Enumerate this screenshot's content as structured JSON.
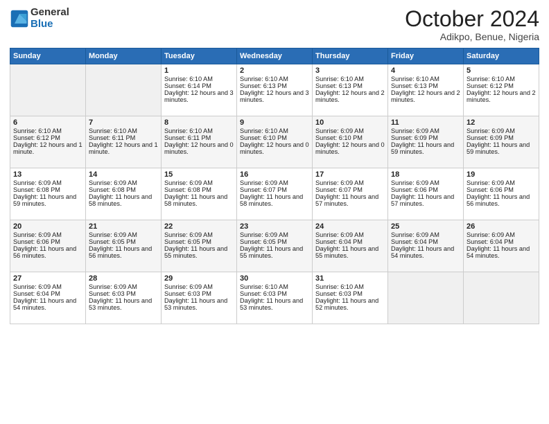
{
  "header": {
    "logo_general": "General",
    "logo_blue": "Blue",
    "month": "October 2024",
    "location": "Adikpo, Benue, Nigeria"
  },
  "days_of_week": [
    "Sunday",
    "Monday",
    "Tuesday",
    "Wednesday",
    "Thursday",
    "Friday",
    "Saturday"
  ],
  "weeks": [
    [
      {
        "day": "",
        "empty": true
      },
      {
        "day": "",
        "empty": true
      },
      {
        "day": "1",
        "sunrise": "Sunrise: 6:10 AM",
        "sunset": "Sunset: 6:14 PM",
        "daylight": "Daylight: 12 hours and 3 minutes."
      },
      {
        "day": "2",
        "sunrise": "Sunrise: 6:10 AM",
        "sunset": "Sunset: 6:13 PM",
        "daylight": "Daylight: 12 hours and 3 minutes."
      },
      {
        "day": "3",
        "sunrise": "Sunrise: 6:10 AM",
        "sunset": "Sunset: 6:13 PM",
        "daylight": "Daylight: 12 hours and 2 minutes."
      },
      {
        "day": "4",
        "sunrise": "Sunrise: 6:10 AM",
        "sunset": "Sunset: 6:13 PM",
        "daylight": "Daylight: 12 hours and 2 minutes."
      },
      {
        "day": "5",
        "sunrise": "Sunrise: 6:10 AM",
        "sunset": "Sunset: 6:12 PM",
        "daylight": "Daylight: 12 hours and 2 minutes."
      }
    ],
    [
      {
        "day": "6",
        "sunrise": "Sunrise: 6:10 AM",
        "sunset": "Sunset: 6:12 PM",
        "daylight": "Daylight: 12 hours and 1 minute."
      },
      {
        "day": "7",
        "sunrise": "Sunrise: 6:10 AM",
        "sunset": "Sunset: 6:11 PM",
        "daylight": "Daylight: 12 hours and 1 minute."
      },
      {
        "day": "8",
        "sunrise": "Sunrise: 6:10 AM",
        "sunset": "Sunset: 6:11 PM",
        "daylight": "Daylight: 12 hours and 0 minutes."
      },
      {
        "day": "9",
        "sunrise": "Sunrise: 6:10 AM",
        "sunset": "Sunset: 6:10 PM",
        "daylight": "Daylight: 12 hours and 0 minutes."
      },
      {
        "day": "10",
        "sunrise": "Sunrise: 6:09 AM",
        "sunset": "Sunset: 6:10 PM",
        "daylight": "Daylight: 12 hours and 0 minutes."
      },
      {
        "day": "11",
        "sunrise": "Sunrise: 6:09 AM",
        "sunset": "Sunset: 6:09 PM",
        "daylight": "Daylight: 11 hours and 59 minutes."
      },
      {
        "day": "12",
        "sunrise": "Sunrise: 6:09 AM",
        "sunset": "Sunset: 6:09 PM",
        "daylight": "Daylight: 11 hours and 59 minutes."
      }
    ],
    [
      {
        "day": "13",
        "sunrise": "Sunrise: 6:09 AM",
        "sunset": "Sunset: 6:08 PM",
        "daylight": "Daylight: 11 hours and 59 minutes."
      },
      {
        "day": "14",
        "sunrise": "Sunrise: 6:09 AM",
        "sunset": "Sunset: 6:08 PM",
        "daylight": "Daylight: 11 hours and 58 minutes."
      },
      {
        "day": "15",
        "sunrise": "Sunrise: 6:09 AM",
        "sunset": "Sunset: 6:08 PM",
        "daylight": "Daylight: 11 hours and 58 minutes."
      },
      {
        "day": "16",
        "sunrise": "Sunrise: 6:09 AM",
        "sunset": "Sunset: 6:07 PM",
        "daylight": "Daylight: 11 hours and 58 minutes."
      },
      {
        "day": "17",
        "sunrise": "Sunrise: 6:09 AM",
        "sunset": "Sunset: 6:07 PM",
        "daylight": "Daylight: 11 hours and 57 minutes."
      },
      {
        "day": "18",
        "sunrise": "Sunrise: 6:09 AM",
        "sunset": "Sunset: 6:06 PM",
        "daylight": "Daylight: 11 hours and 57 minutes."
      },
      {
        "day": "19",
        "sunrise": "Sunrise: 6:09 AM",
        "sunset": "Sunset: 6:06 PM",
        "daylight": "Daylight: 11 hours and 56 minutes."
      }
    ],
    [
      {
        "day": "20",
        "sunrise": "Sunrise: 6:09 AM",
        "sunset": "Sunset: 6:06 PM",
        "daylight": "Daylight: 11 hours and 56 minutes."
      },
      {
        "day": "21",
        "sunrise": "Sunrise: 6:09 AM",
        "sunset": "Sunset: 6:05 PM",
        "daylight": "Daylight: 11 hours and 56 minutes."
      },
      {
        "day": "22",
        "sunrise": "Sunrise: 6:09 AM",
        "sunset": "Sunset: 6:05 PM",
        "daylight": "Daylight: 11 hours and 55 minutes."
      },
      {
        "day": "23",
        "sunrise": "Sunrise: 6:09 AM",
        "sunset": "Sunset: 6:05 PM",
        "daylight": "Daylight: 11 hours and 55 minutes."
      },
      {
        "day": "24",
        "sunrise": "Sunrise: 6:09 AM",
        "sunset": "Sunset: 6:04 PM",
        "daylight": "Daylight: 11 hours and 55 minutes."
      },
      {
        "day": "25",
        "sunrise": "Sunrise: 6:09 AM",
        "sunset": "Sunset: 6:04 PM",
        "daylight": "Daylight: 11 hours and 54 minutes."
      },
      {
        "day": "26",
        "sunrise": "Sunrise: 6:09 AM",
        "sunset": "Sunset: 6:04 PM",
        "daylight": "Daylight: 11 hours and 54 minutes."
      }
    ],
    [
      {
        "day": "27",
        "sunrise": "Sunrise: 6:09 AM",
        "sunset": "Sunset: 6:04 PM",
        "daylight": "Daylight: 11 hours and 54 minutes."
      },
      {
        "day": "28",
        "sunrise": "Sunrise: 6:09 AM",
        "sunset": "Sunset: 6:03 PM",
        "daylight": "Daylight: 11 hours and 53 minutes."
      },
      {
        "day": "29",
        "sunrise": "Sunrise: 6:09 AM",
        "sunset": "Sunset: 6:03 PM",
        "daylight": "Daylight: 11 hours and 53 minutes."
      },
      {
        "day": "30",
        "sunrise": "Sunrise: 6:10 AM",
        "sunset": "Sunset: 6:03 PM",
        "daylight": "Daylight: 11 hours and 53 minutes."
      },
      {
        "day": "31",
        "sunrise": "Sunrise: 6:10 AM",
        "sunset": "Sunset: 6:03 PM",
        "daylight": "Daylight: 11 hours and 52 minutes."
      },
      {
        "day": "",
        "empty": true
      },
      {
        "day": "",
        "empty": true
      }
    ]
  ]
}
